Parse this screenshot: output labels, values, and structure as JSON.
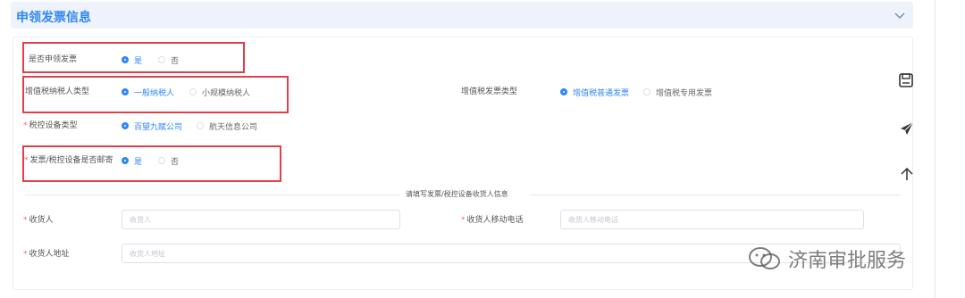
{
  "section": {
    "title": "申领发票信息"
  },
  "fields": {
    "apply_invoice": {
      "label": "是否申领发票",
      "options": [
        {
          "label": "是",
          "checked": true
        },
        {
          "label": "否",
          "checked": false
        }
      ]
    },
    "taxpayer_type": {
      "label": "增值税纳税人类型",
      "options": [
        {
          "label": "一般纳税人",
          "checked": true
        },
        {
          "label": "小规模纳税人",
          "checked": false
        }
      ]
    },
    "vat_invoice_type": {
      "label": "增值税发票类型",
      "options": [
        {
          "label": "增值税普通发票",
          "checked": true
        },
        {
          "label": "增值税专用发票",
          "checked": false
        }
      ]
    },
    "tax_device_type": {
      "label": "税控设备类型",
      "options": [
        {
          "label": "百望九赋公司",
          "checked": true
        },
        {
          "label": "航天信息公司",
          "checked": false
        }
      ]
    },
    "mail_device": {
      "label": "发票/税控设备是否邮寄",
      "options": [
        {
          "label": "是",
          "checked": true
        },
        {
          "label": "否",
          "checked": false
        }
      ]
    }
  },
  "consignee_section": {
    "title": "请填写发票/税控设备收货人信息"
  },
  "consignee": {
    "name": {
      "label": "收货人",
      "placeholder": "收货人",
      "value": ""
    },
    "mobile": {
      "label": "收货人移动电话",
      "placeholder": "收货人移动电话",
      "value": ""
    },
    "address": {
      "label": "收货人地址",
      "placeholder": "收货人地址",
      "value": ""
    }
  },
  "side_toolbar": {
    "icons": [
      "save-icon",
      "send-icon",
      "arrow-up-icon"
    ]
  },
  "watermark": {
    "text": "济南审批服务"
  },
  "colors": {
    "accent": "#2f86f6",
    "required": "#f56c6c",
    "highlight_box": "#e0404b"
  }
}
